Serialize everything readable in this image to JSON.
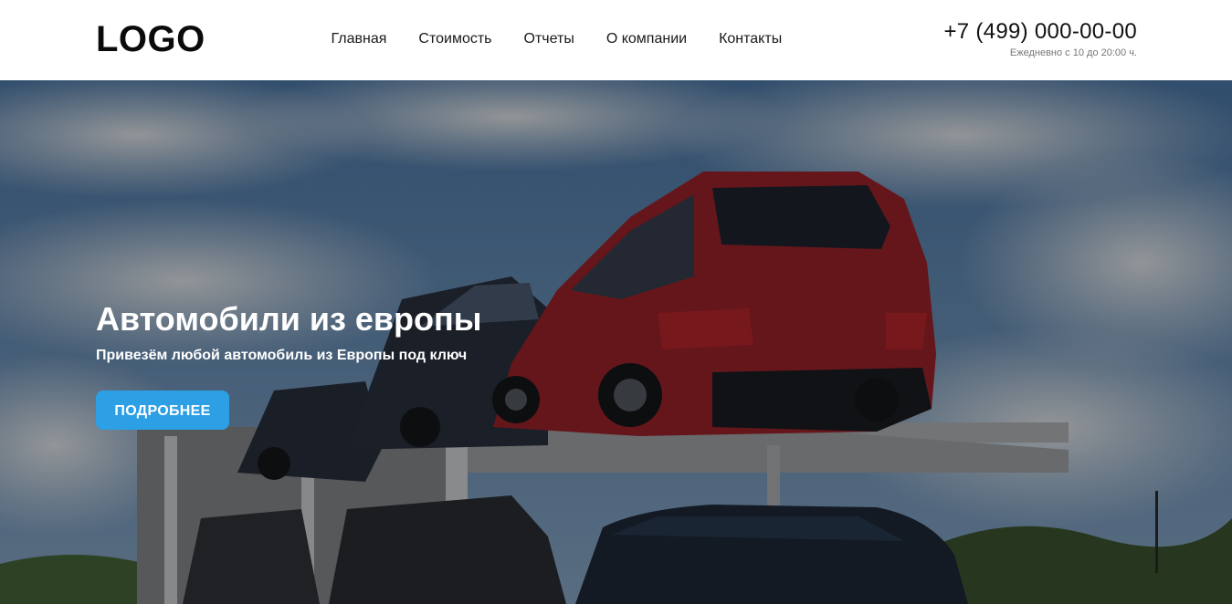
{
  "header": {
    "logo": "LOGO",
    "nav": [
      {
        "label": "Главная"
      },
      {
        "label": "Стоимость"
      },
      {
        "label": "Отчеты"
      },
      {
        "label": "О компании"
      },
      {
        "label": "Контакты"
      }
    ],
    "phone": "+7 (499) 000-00-00",
    "hours": "Ежедневно с 10 до 20:00 ч."
  },
  "hero": {
    "title": "Автомобили из европы",
    "subtitle": "Привезём любой автомобиль из Европы под ключ",
    "button_label": "ПОДРОБНЕЕ",
    "image": "car-transporter-photo"
  },
  "colors": {
    "accent": "#2d9fe5",
    "header_bg": "#ffffff",
    "text_dark": "#1a1a1a",
    "hero_text": "#ffffff"
  }
}
